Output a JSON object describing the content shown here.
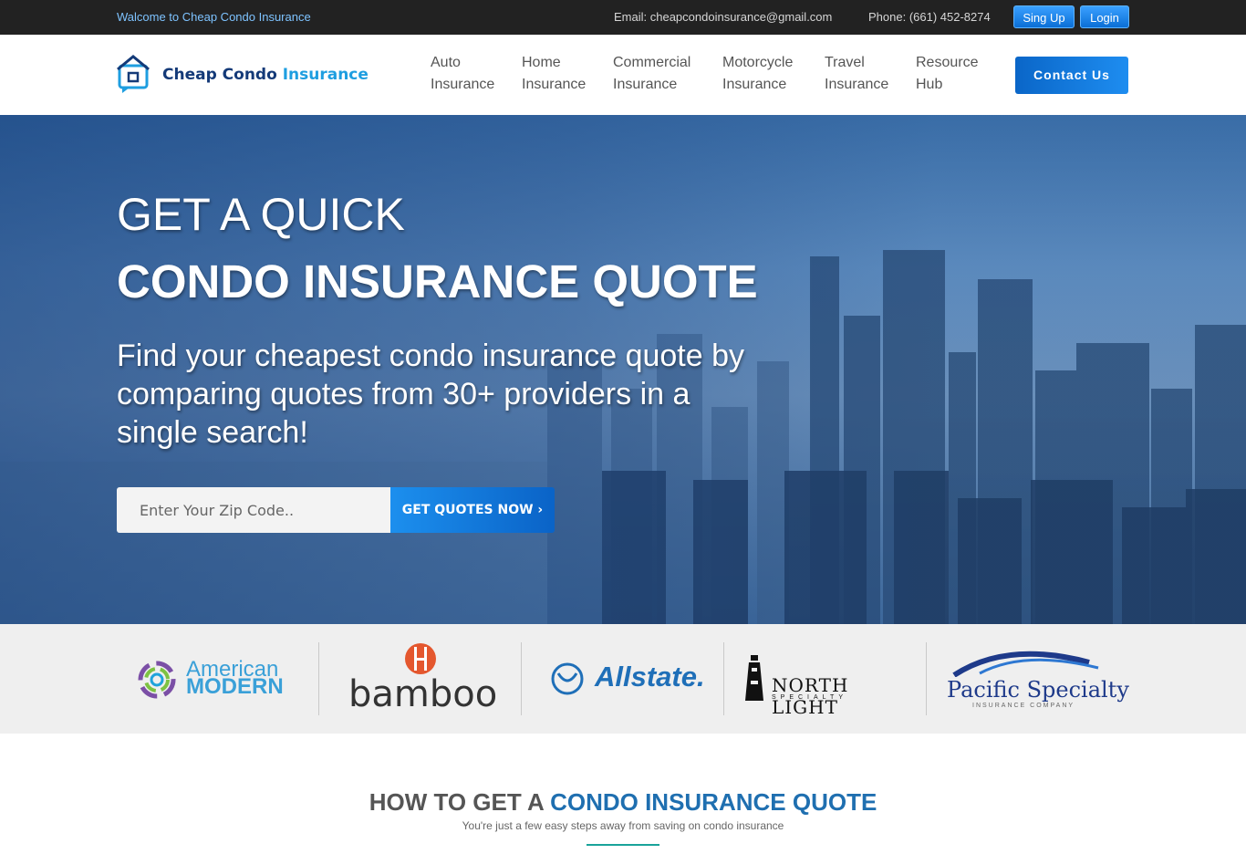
{
  "topbar": {
    "welcome": "Walcome to Cheap Condo Insurance",
    "email": "Email: cheapcondoinsurance@gmail.com",
    "phone": "Phone: (661) 452-8274",
    "signup_label": "Sing Up",
    "login_label": "Login"
  },
  "header": {
    "logo_text_main": "Cheap Condo ",
    "logo_text_accent": "Insurance",
    "nav": [
      {
        "line1": "Auto",
        "line2": "Insurance"
      },
      {
        "line1": "Home",
        "line2": "Insurance"
      },
      {
        "line1": "Commercial",
        "line2": "Insurance"
      },
      {
        "line1": "Motorcycle",
        "line2": "Insurance"
      },
      {
        "line1": "Travel",
        "line2": "Insurance"
      },
      {
        "line1": "Resource",
        "line2": "Hub"
      }
    ],
    "contact_label": "Contact Us"
  },
  "hero": {
    "title_line1": "GET A QUICK",
    "title_line2": "CONDO INSURANCE QUOTE",
    "description": "Find your cheapest condo insurance quote by comparing quotes from 30+ providers in a single search!",
    "zip_placeholder": "Enter Your Zip Code..",
    "cta_label": "GET QUOTES NOW ›"
  },
  "partners": {
    "american_modern_1": "American",
    "american_modern_2": "MODERN",
    "bamboo": "bamboo",
    "allstate": "Allstate.",
    "north_light_1": "NORTH LIGHT",
    "north_light_2": "SPECIALTY",
    "pacific_1": "Pacific Specialty",
    "pacific_2": "INSURANCE COMPANY"
  },
  "section": {
    "title_gray": "HOW TO GET A ",
    "title_blue": "CONDO INSURANCE QUOTE",
    "subtitle": "You're just a few easy steps away from saving on condo insurance"
  },
  "colors": {
    "topbar_bg": "#222222",
    "accent_blue": "#0a66c8",
    "section_blue": "#1f6fb0",
    "teal_line": "#19a39a"
  }
}
